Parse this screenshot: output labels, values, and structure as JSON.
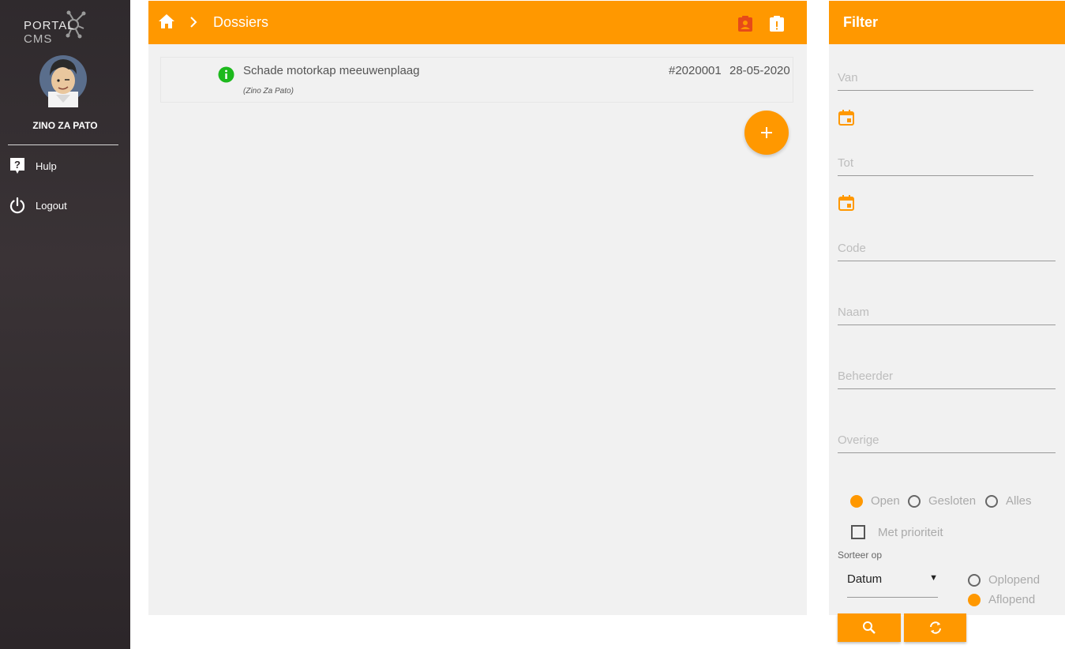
{
  "sidebar": {
    "logo_portal": "PORTAL",
    "logo_cms": "CMS",
    "user_name": "ZINO ZA PATO",
    "items": [
      {
        "label": "Hulp",
        "icon": "help-icon"
      },
      {
        "label": "Logout",
        "icon": "power-icon"
      }
    ]
  },
  "header": {
    "title": "Dossiers",
    "icons": [
      "contact-icon",
      "clipboard-alert-icon"
    ]
  },
  "dossiers": [
    {
      "title": "Schade motorkap meeuwenplaag",
      "owner": "(Zino Za Pato)",
      "code": "#2020001",
      "date": "28-05-2020",
      "status_icon": "info-icon"
    }
  ],
  "filter": {
    "title": "Filter",
    "van": "Van",
    "tot": "Tot",
    "code": "Code",
    "naam": "Naam",
    "beheerder": "Beheerder",
    "overige": "Overige",
    "status_options": [
      "Open",
      "Gesloten",
      "Alles"
    ],
    "status_selected": "Open",
    "priority_label": "Met prioriteit",
    "priority_checked": false,
    "sort_label": "Sorteer op",
    "sort_value": "Datum",
    "order_options": [
      "Oplopend",
      "Aflopend"
    ],
    "order_selected": "Aflopend"
  },
  "colors": {
    "accent": "#ff9800",
    "sidebar": "#2f2a2d",
    "info": "#1db91d"
  }
}
